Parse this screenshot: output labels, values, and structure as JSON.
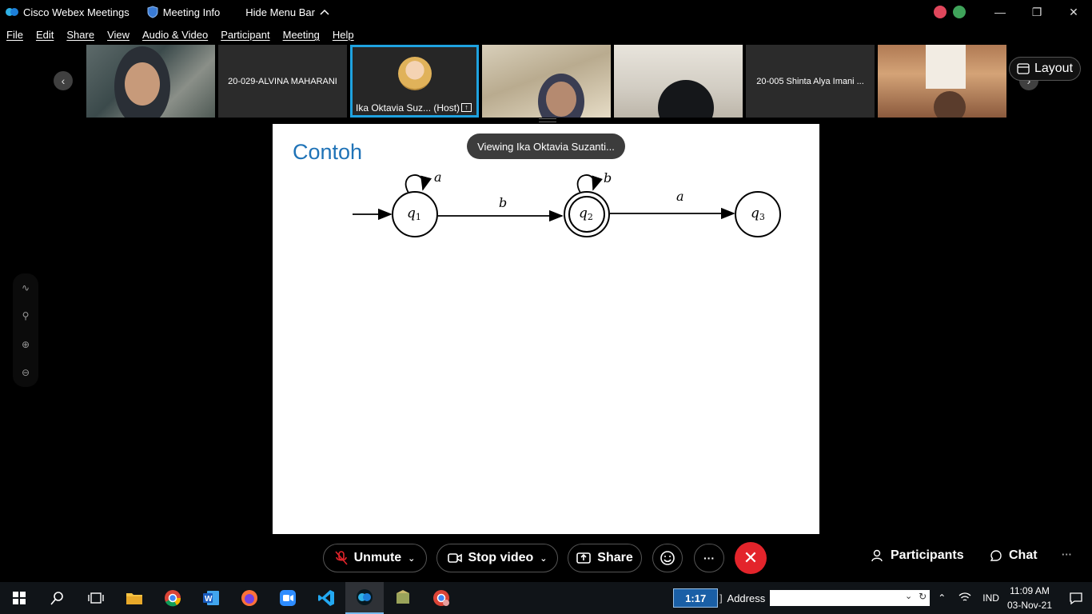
{
  "titlebar": {
    "app_title": "Cisco Webex Meetings",
    "meeting_info": "Meeting Info",
    "hide_menu": "Hide Menu Bar"
  },
  "menu": [
    "File",
    "Edit",
    "Share",
    "View",
    "Audio & Video",
    "Participant",
    "Meeting",
    "Help"
  ],
  "participants": [
    {
      "name": "",
      "type": "video"
    },
    {
      "name": "20-029-ALVINA MAHARANI",
      "type": "name"
    },
    {
      "name": "Ika  Oktavia Suz...  (Host)",
      "type": "host"
    },
    {
      "name": "",
      "type": "video"
    },
    {
      "name": "",
      "type": "video"
    },
    {
      "name": "20-005 Shinta Alya Imani ...",
      "type": "name"
    },
    {
      "name": "",
      "type": "video"
    }
  ],
  "layout_label": "Layout",
  "toast": "Viewing Ika  Oktavia Suzanti...",
  "slide": {
    "title": "Contoh",
    "states": [
      "q1",
      "q2",
      "q3"
    ],
    "labels": {
      "loop1": "a",
      "edge12": "b",
      "loop2": "b",
      "edge23": "a"
    },
    "state_text": {
      "q1_sub": "1",
      "q2_sub": "2",
      "q3_sub": "3",
      "q": "q"
    }
  },
  "controls": {
    "unmute": "Unmute",
    "stop_video": "Stop video",
    "share": "Share",
    "participants": "Participants",
    "chat": "Chat",
    "more": "···"
  },
  "taskbar": {
    "timer": "1:17",
    "address_label": "Address",
    "lang": "IND",
    "time": "11:09 AM",
    "date": "03-Nov-21"
  },
  "colors": {
    "accent": "#1fa2e0",
    "end_call": "#e3242b",
    "slide_title": "#1f73b7"
  }
}
